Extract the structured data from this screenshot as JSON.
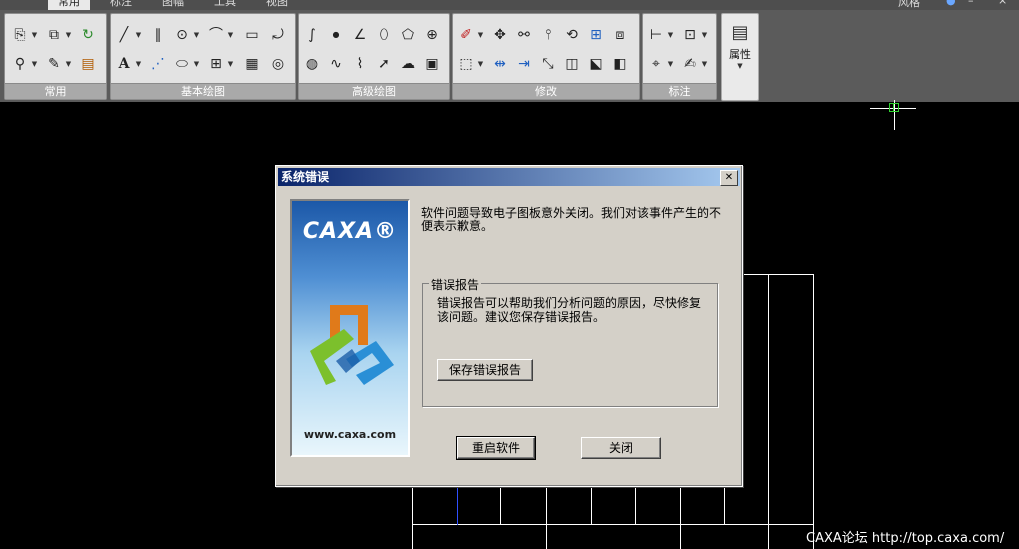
{
  "ribbon": {
    "tabs": [
      "常用",
      "标注",
      "图幅",
      "工具",
      "视图"
    ],
    "active_tab": "常用",
    "right_menu": "风格",
    "groups": [
      {
        "label": "常用"
      },
      {
        "label": "基本绘图"
      },
      {
        "label": "高级绘图"
      },
      {
        "label": "修改"
      },
      {
        "label": "标注"
      }
    ],
    "properties_label": "属性"
  },
  "dialog": {
    "title": "系统错误",
    "brand": "CAXA®",
    "url": "www.caxa.com",
    "message": "软件问题导致电子图板意外关闭。我们对该事件产生的不便表示歉意。",
    "report_group_title": "错误报告",
    "report_text": "错误报告可以帮助我们分析问题的原因，尽快修复该问题。建议您保存错误报告。",
    "save_report_label": "保存错误报告",
    "restart_label": "重启软件",
    "close_label": "关闭"
  },
  "watermark": "CAXA论坛 http://top.caxa.com/",
  "colors": {
    "titlebar_start": "#0a246a",
    "titlebar_end": "#a6caf0",
    "canvas": "#000000",
    "ribbon": "#5b5b5b"
  }
}
